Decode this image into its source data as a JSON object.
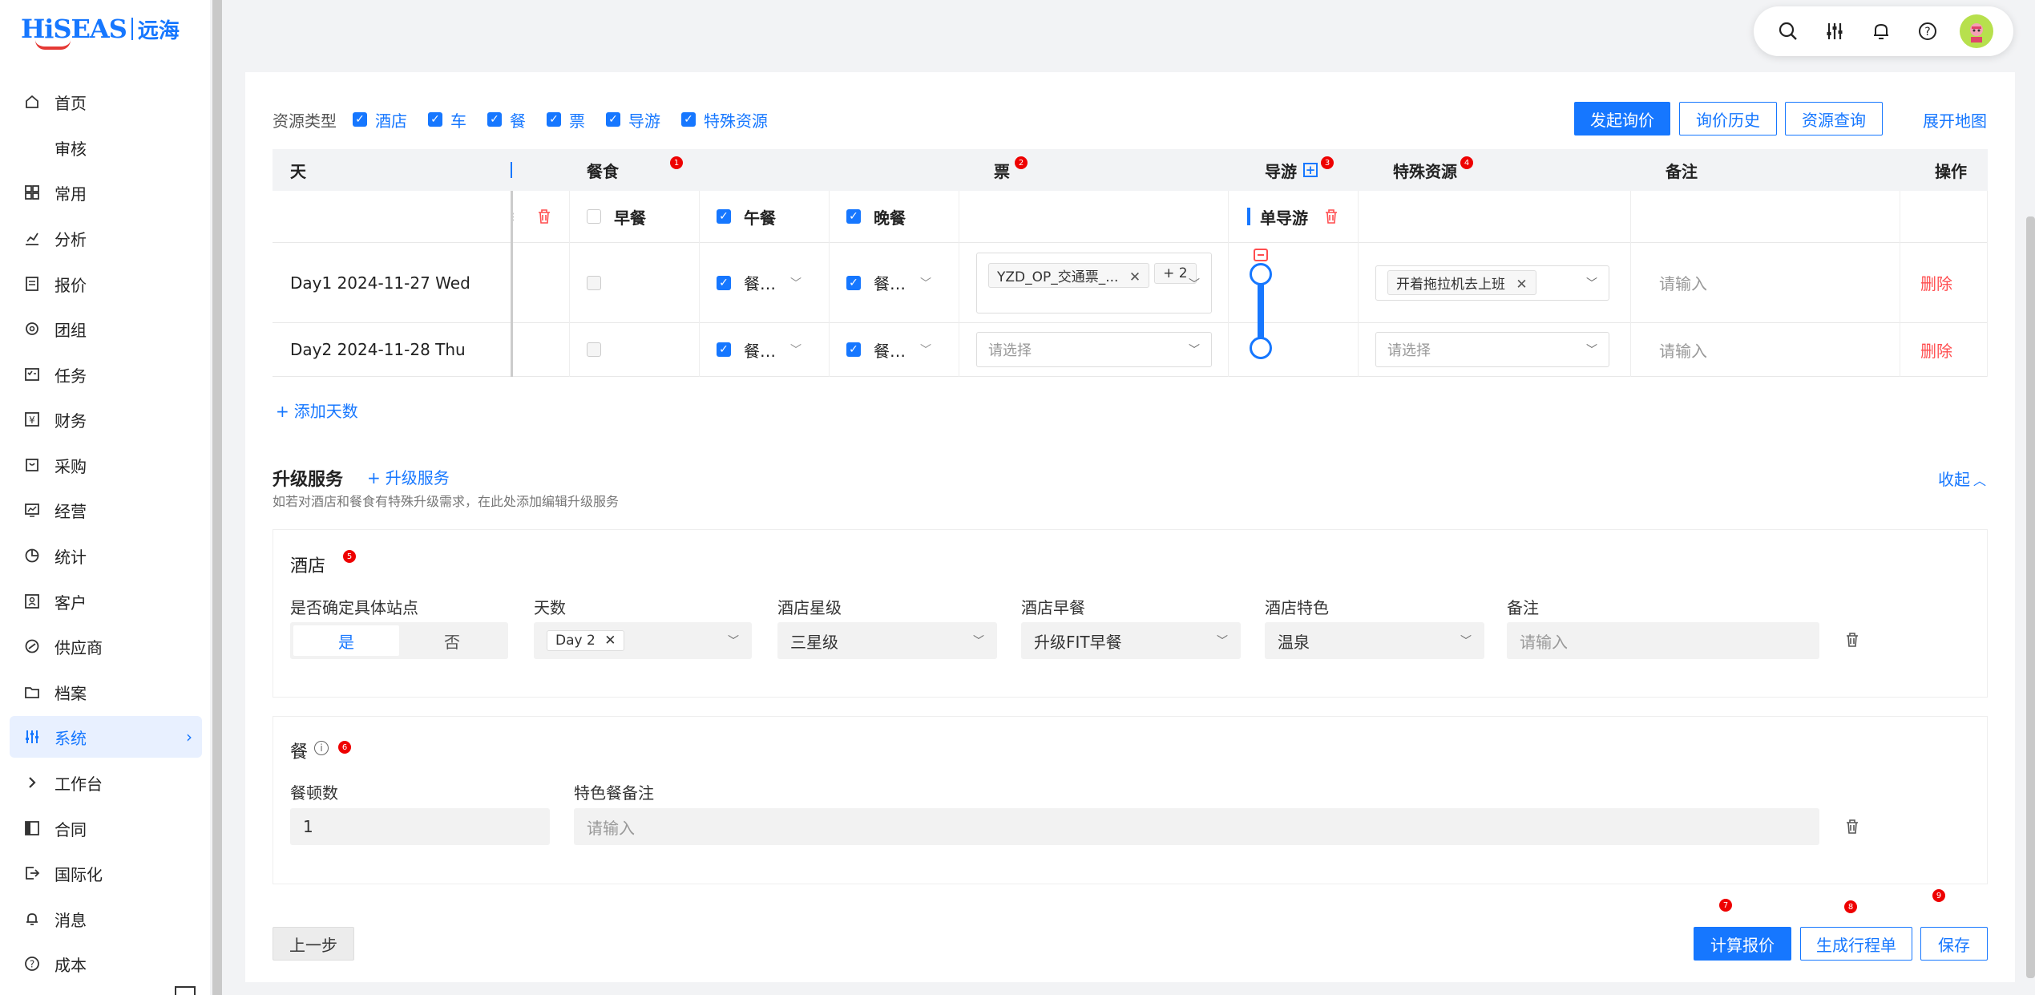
{
  "logo": {
    "brand": "HiSEAS",
    "cn": "远海"
  },
  "sidebar": {
    "items": [
      {
        "label": "首页",
        "icon": "home-icon"
      },
      {
        "label": "审核",
        "icon": ""
      },
      {
        "label": "常用",
        "icon": "grid-icon"
      },
      {
        "label": "分析",
        "icon": "chart-icon"
      },
      {
        "label": "报价",
        "icon": "doc-icon"
      },
      {
        "label": "团组",
        "icon": "group-icon"
      },
      {
        "label": "任务",
        "icon": "task-icon"
      },
      {
        "label": "财务",
        "icon": "yen-icon"
      },
      {
        "label": "采购",
        "icon": "cart-icon"
      },
      {
        "label": "经营",
        "icon": "monitor-icon"
      },
      {
        "label": "统计",
        "icon": "pie-icon"
      },
      {
        "label": "客户",
        "icon": "contact-icon"
      },
      {
        "label": "供应商",
        "icon": "link-icon"
      },
      {
        "label": "档案",
        "icon": "folder-icon"
      },
      {
        "label": "系统",
        "icon": "sliders-icon"
      },
      {
        "label": "工作台",
        "icon": "chevron-right-icon"
      },
      {
        "label": "合同",
        "icon": "book-icon"
      },
      {
        "label": "国际化",
        "icon": "exit-icon"
      },
      {
        "label": "消息",
        "icon": "bell-icon"
      },
      {
        "label": "成本",
        "icon": "question-icon"
      }
    ]
  },
  "filters": {
    "label": "资源类型",
    "items": [
      "酒店",
      "车",
      "餐",
      "票",
      "导游",
      "特殊资源"
    ]
  },
  "actions": {
    "inquiry": "发起询价",
    "history": "询价历史",
    "resource": "资源查询",
    "map": "展开地图"
  },
  "table": {
    "headers": {
      "day": "天",
      "meal": "餐食",
      "ticket": "票",
      "guide": "导游",
      "special": "特殊资源",
      "note": "备注",
      "op": "操作"
    },
    "badges": {
      "meal": "1",
      "ticket": "2",
      "guide": "3",
      "special": "4"
    },
    "subheaders": {
      "breakfast": "早餐",
      "lunch": "午餐",
      "dinner": "晚餐",
      "guide": "单导游"
    },
    "rows": [
      {
        "day": "Day1 2024-11-27 Wed",
        "lunch": "餐…",
        "dinner": "餐…",
        "ticket_tag": "YZD_OP_交通票_...",
        "ticket_more": "+ 2",
        "special_tag": "开着拖拉机去上班",
        "note": "请输入",
        "op": "删除"
      },
      {
        "day": "Day2 2024-11-28 Thu",
        "lunch": "餐…",
        "dinner": "餐…",
        "ticket_placeholder": "请选择",
        "special_placeholder": "请选择",
        "note": "请输入",
        "op": "删除"
      }
    ],
    "add_day": "添加天数"
  },
  "upgrade": {
    "title": "升级服务",
    "add": "升级服务",
    "desc": "如若对酒店和餐食有特殊升级需求，在此处添加编辑升级服务",
    "collapse": "收起",
    "hotel": {
      "title": "酒店",
      "badge": "5",
      "fields": {
        "station": "是否确定具体站点",
        "days": "天数",
        "star": "酒店星级",
        "breakfast": "酒店早餐",
        "feature": "酒店特色",
        "note": "备注"
      },
      "values": {
        "yes": "是",
        "no": "否",
        "day_tag": "Day 2",
        "star": "三星级",
        "breakfast": "升级FIT早餐",
        "feature": "温泉",
        "note_placeholder": "请输入"
      }
    },
    "meal": {
      "title": "餐",
      "badge": "6",
      "fields": {
        "count": "餐顿数",
        "note": "特色餐备注"
      },
      "values": {
        "count": "1",
        "note_placeholder": "请输入"
      }
    }
  },
  "footer": {
    "prev": "上一步",
    "calc": "计算报价",
    "gen": "生成行程单",
    "save": "保存",
    "badges": {
      "calc": "7",
      "gen": "8",
      "save": "9"
    }
  },
  "colors": {
    "primary": "#1677ff",
    "danger": "#ff4d4f",
    "badge": "#e00000"
  }
}
